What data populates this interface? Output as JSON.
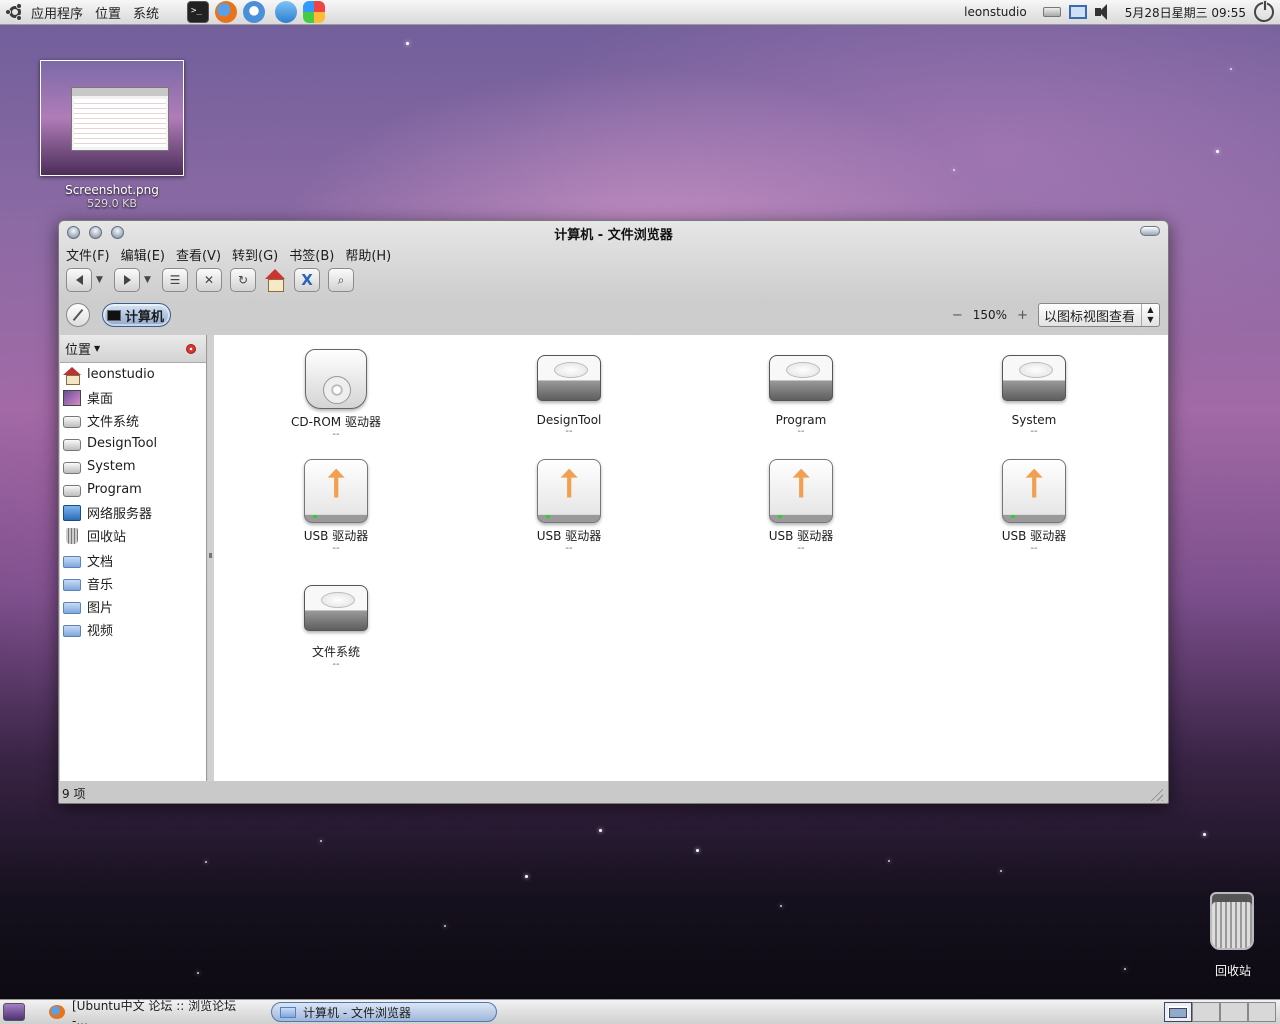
{
  "top_panel": {
    "menus": [
      "应用程序",
      "位置",
      "系统"
    ],
    "username": "leonstudio",
    "clock": "5月28日星期三 09:55"
  },
  "desktop": {
    "screenshot_file": {
      "name": "Screenshot.png",
      "size": "529.0 KB"
    },
    "trash_label": "回收站"
  },
  "window": {
    "title": "计算机 - 文件浏览器",
    "menu": [
      "文件(F)",
      "编辑(E)",
      "查看(V)",
      "转到(G)",
      "书签(B)",
      "帮助(H)"
    ],
    "location_crumb": "计算机",
    "zoom": {
      "minus": "−",
      "value": "150%",
      "plus": "+"
    },
    "view_mode": "以图标视图查看",
    "sidebar": {
      "header": "位置",
      "items": [
        {
          "label": "leonstudio",
          "icon": "home-icon"
        },
        {
          "label": "桌面",
          "icon": "desktop-icon"
        },
        {
          "label": "文件系统",
          "icon": "drive-icon"
        },
        {
          "label": "DesignTool",
          "icon": "drive-icon"
        },
        {
          "label": "System",
          "icon": "drive-icon"
        },
        {
          "label": "Program",
          "icon": "drive-icon"
        },
        {
          "label": "网络服务器",
          "icon": "network-icon"
        },
        {
          "label": "回收站",
          "icon": "trash-icon"
        },
        {
          "label": "文档",
          "icon": "folder-icon"
        },
        {
          "label": "音乐",
          "icon": "folder-icon"
        },
        {
          "label": "图片",
          "icon": "folder-icon"
        },
        {
          "label": "视频",
          "icon": "folder-icon"
        }
      ]
    },
    "files": [
      {
        "name": "CD-ROM 驱动器",
        "sub": "--",
        "icon": "cdrom-icon"
      },
      {
        "name": "DesignTool",
        "sub": "--",
        "icon": "harddisk-icon"
      },
      {
        "name": "Program",
        "sub": "--",
        "icon": "harddisk-icon"
      },
      {
        "name": "System",
        "sub": "--",
        "icon": "harddisk-icon"
      },
      {
        "name": "USB 驱动器",
        "sub": "--",
        "icon": "usb-drive-icon"
      },
      {
        "name": "USB 驱动器",
        "sub": "--",
        "icon": "usb-drive-icon"
      },
      {
        "name": "USB 驱动器",
        "sub": "--",
        "icon": "usb-drive-icon"
      },
      {
        "name": "USB 驱动器",
        "sub": "--",
        "icon": "usb-drive-icon"
      },
      {
        "name": "文件系统",
        "sub": "--",
        "icon": "harddisk-icon"
      }
    ],
    "status": "9 项"
  },
  "bottom_panel": {
    "tasks": [
      {
        "label": "[Ubuntu中文 论坛 :: 浏览论坛 -..."
      },
      {
        "label": "计算机 - 文件浏览器"
      }
    ]
  }
}
